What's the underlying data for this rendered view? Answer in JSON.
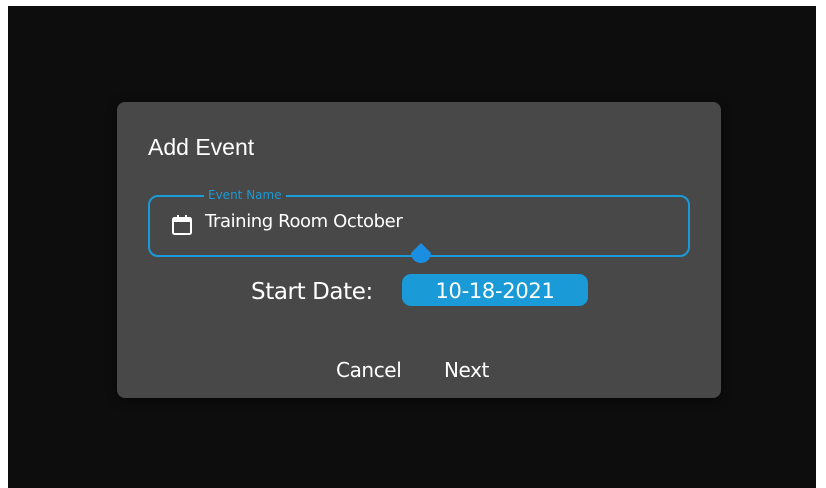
{
  "dialog": {
    "title": "Add Event",
    "event_name": {
      "label": "Event Name",
      "value": "Training Room October",
      "icon": "calendar-icon"
    },
    "start_date": {
      "label": "Start Date:",
      "value": "10-18-2021"
    },
    "actions": {
      "cancel_label": "Cancel",
      "next_label": "Next"
    }
  },
  "colors": {
    "accent": "#1a9ad6",
    "dialog_bg": "#484848",
    "backdrop": "#0d0d0d"
  }
}
